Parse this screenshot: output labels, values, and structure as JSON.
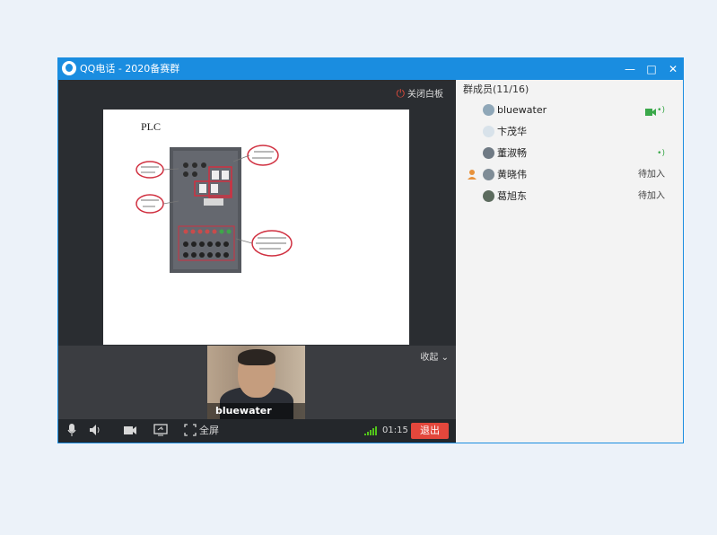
{
  "window": {
    "title": "QQ电话 - 2020备赛群",
    "colors": {
      "titlebar": "#1a8de0",
      "exit": "#e3473c",
      "signal": "#52c41a"
    }
  },
  "stage": {
    "close_whiteboard": "关闭白板",
    "whiteboard": {
      "heading": "PLC"
    },
    "collapse": "收起",
    "video": {
      "name": "bluewater"
    }
  },
  "controls": {
    "fullscreen": "全屏",
    "timer": "01:15",
    "exit": "退出"
  },
  "members": {
    "title": "群成员(11/16)",
    "list": [
      {
        "name": "bluewater",
        "status": ""
      },
      {
        "name": "卞茂华",
        "status": ""
      },
      {
        "name": "董淑畅",
        "status": ""
      },
      {
        "name": "黄晓伟",
        "status": "待加入"
      },
      {
        "name": "葛旭东",
        "status": "待加入"
      }
    ]
  },
  "icons": [
    "app-logo-icon",
    "minimize-icon",
    "maximize-icon",
    "close-icon",
    "power-icon",
    "double-chevron-down-icon",
    "microphone-icon",
    "speaker-icon",
    "camera-icon",
    "screen-share-icon",
    "fullscreen-icon",
    "signal-icon",
    "video-on-icon",
    "audio-wave-icon",
    "owner-icon"
  ]
}
